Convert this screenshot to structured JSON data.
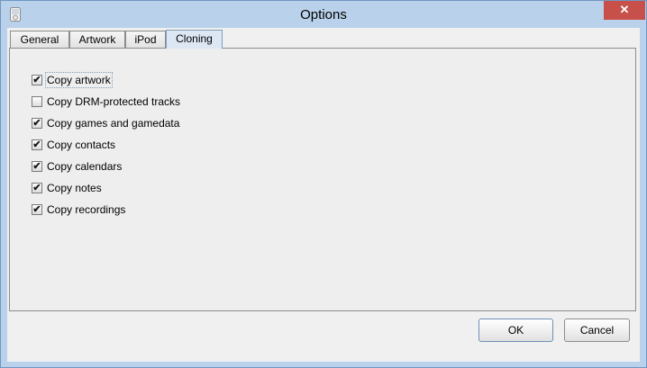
{
  "window": {
    "title": "Options"
  },
  "tabs": [
    {
      "label": "General"
    },
    {
      "label": "Artwork"
    },
    {
      "label": "iPod"
    },
    {
      "label": "Cloning",
      "selected": true
    }
  ],
  "options": [
    {
      "label": "Copy artwork",
      "checked": true
    },
    {
      "label": "Copy DRM-protected tracks",
      "checked": false
    },
    {
      "label": "Copy games and gamedata",
      "checked": true
    },
    {
      "label": "Copy contacts",
      "checked": true
    },
    {
      "label": "Copy calendars",
      "checked": true
    },
    {
      "label": "Copy notes",
      "checked": true
    },
    {
      "label": "Copy recordings",
      "checked": true
    }
  ],
  "buttons": {
    "ok": "OK",
    "cancel": "Cancel"
  },
  "icons": {
    "close": "close-icon",
    "check": "check-icon"
  }
}
